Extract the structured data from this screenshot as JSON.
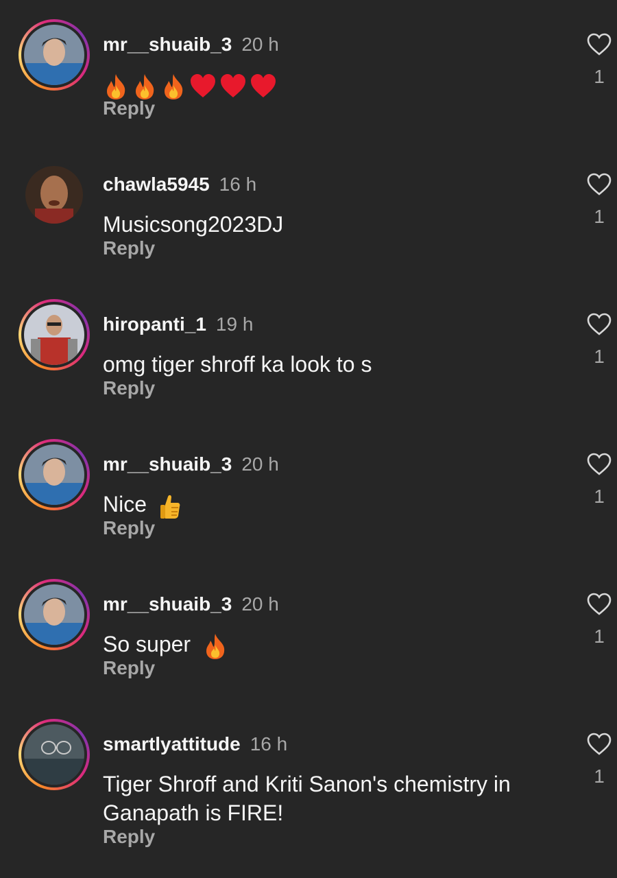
{
  "comments": [
    {
      "username": "mr__shuaib_3",
      "time": "20 h",
      "text": "🔥🔥🔥❤️❤️❤️",
      "emojis": [
        "fire-icon",
        "fire-icon",
        "fire-icon",
        "heart-icon",
        "heart-icon",
        "heart-icon"
      ],
      "reply_label": "Reply",
      "likes": "1",
      "story_ring": true
    },
    {
      "username": "chawla5945",
      "time": "16 h",
      "text": "Musicsong2023DJ",
      "reply_label": "Reply",
      "likes": "1",
      "story_ring": false
    },
    {
      "username": "hiropanti_1",
      "time": "19 h",
      "text": "omg tiger shroff ka look to s",
      "reply_label": "Reply",
      "likes": "1",
      "story_ring": true
    },
    {
      "username": "mr__shuaib_3",
      "time": "20 h",
      "text": "Nice",
      "emojis": [
        "thumbs-up-icon"
      ],
      "reply_label": "Reply",
      "likes": "1",
      "story_ring": true
    },
    {
      "username": "mr__shuaib_3",
      "time": "20 h",
      "text": "So super",
      "emojis": [
        "fire-icon"
      ],
      "reply_label": "Reply",
      "likes": "1",
      "story_ring": true
    },
    {
      "username": "smartlyattitude",
      "time": "16 h",
      "text": "Tiger Shroff and Kriti Sanon's chemistry in Ganapath is FIRE!",
      "reply_label": "Reply",
      "likes": "1",
      "story_ring": true
    }
  ],
  "colors": {
    "background": "#262626",
    "text_primary": "#f5f5f5",
    "text_secondary": "#a8a8a8"
  }
}
